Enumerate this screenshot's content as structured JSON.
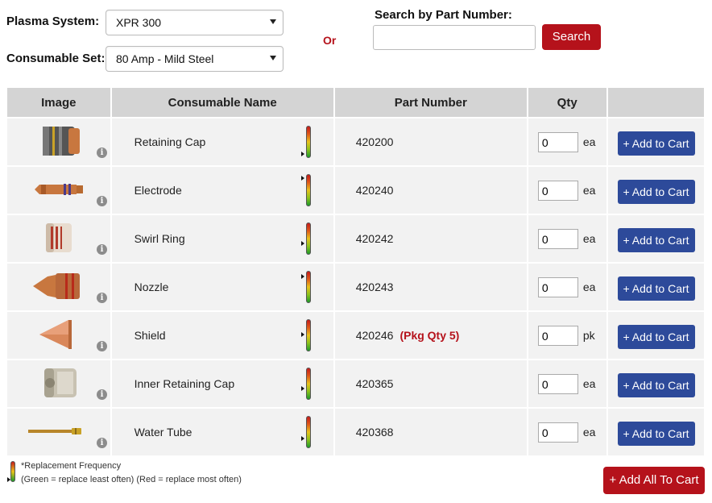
{
  "filters": {
    "plasma_label": "Plasma System:",
    "plasma_value": "XPR 300",
    "consumable_label": "Consumable Set:",
    "consumable_value": "80 Amp - Mild Steel",
    "or_text": "Or",
    "search_label": "Search by Part Number:",
    "search_value": "",
    "search_button": "Search"
  },
  "table": {
    "headers": [
      "Image",
      "Consumable Name",
      "Part Number",
      "Qty",
      ""
    ],
    "rows": [
      {
        "name": "Retaining Cap",
        "part": "420200",
        "pkg": "",
        "qty": "0",
        "unit": "ea",
        "cart": "+ Add to Cart",
        "frequency": 0.1
      },
      {
        "name": "Electrode",
        "part": "420240",
        "pkg": "",
        "qty": "0",
        "unit": "ea",
        "cart": "+ Add to Cart",
        "frequency": 0.95
      },
      {
        "name": "Swirl Ring",
        "part": "420242",
        "pkg": "",
        "qty": "0",
        "unit": "ea",
        "cart": "+ Add to Cart",
        "frequency": 0.35
      },
      {
        "name": "Nozzle",
        "part": "420243",
        "pkg": "",
        "qty": "0",
        "unit": "ea",
        "cart": "+ Add to Cart",
        "frequency": 0.9
      },
      {
        "name": "Shield",
        "part": "420246",
        "pkg": "(Pkg Qty 5)",
        "qty": "0",
        "unit": "pk",
        "cart": "+ Add to Cart",
        "frequency": 0.55
      },
      {
        "name": "Inner Retaining Cap",
        "part": "420365",
        "pkg": "",
        "qty": "0",
        "unit": "ea",
        "cart": "+ Add to Cart",
        "frequency": 0.35
      },
      {
        "name": "Water Tube",
        "part": "420368",
        "pkg": "",
        "qty": "0",
        "unit": "ea",
        "cart": "+ Add to Cart",
        "frequency": 0.3
      }
    ]
  },
  "legend": {
    "line1": "*Replacement Frequency",
    "line2": "(Green = replace least often) (Red = replace most often)"
  },
  "add_all_button": "+ Add All To Cart",
  "colors": {
    "accent_red": "#b5121b",
    "button_blue": "#2d4a9a",
    "header_gray": "#d4d4d4"
  }
}
